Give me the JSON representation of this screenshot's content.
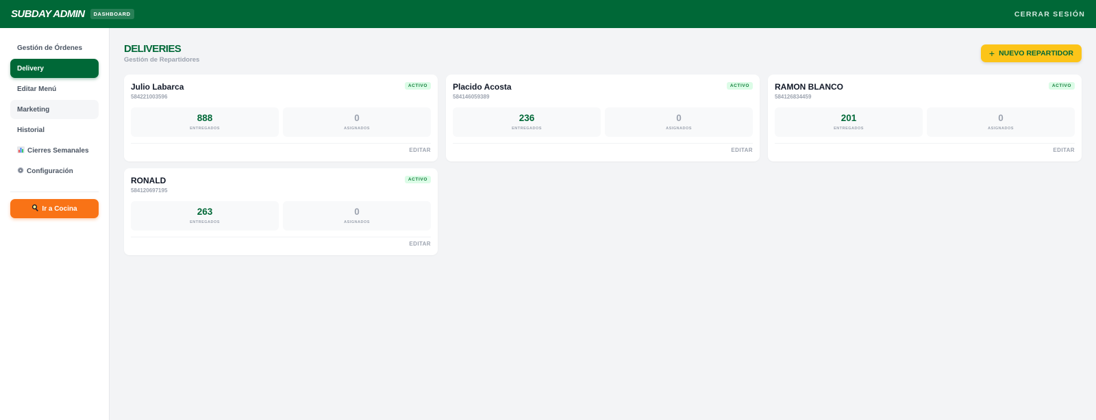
{
  "header": {
    "brand": "SUBDAY ADMIN",
    "badge": "DASHBOARD",
    "logout": "CERRAR SESIÓN"
  },
  "sidebar": {
    "items": [
      {
        "label": "Gestión de Órdenes",
        "icon": "",
        "active": false
      },
      {
        "label": "Delivery",
        "icon": "",
        "active": true
      },
      {
        "label": "Editar Menú",
        "icon": "",
        "active": false
      },
      {
        "label": "Marketing",
        "icon": "",
        "active": false
      },
      {
        "label": "Historial",
        "icon": "",
        "active": false
      },
      {
        "label": "Cierres Semanales",
        "icon": "bar-chart-icon",
        "active": false
      },
      {
        "label": "Configuración",
        "icon": "gear-icon",
        "active": false
      }
    ],
    "kitchen_button": "Ir a Cocina",
    "kitchen_icon": "frying-pan-icon"
  },
  "main": {
    "title": "DELIVERIES",
    "subtitle": "Gestión de Repartidores",
    "new_button": "NUEVO REPARTIDOR",
    "new_button_icon": "+",
    "cards": [
      {
        "name": "Julio Labarca",
        "phone": "584221003596",
        "status": "ACTIVO",
        "delivered": "888",
        "delivered_label": "ENTREGADOS",
        "assigned": "0",
        "assigned_label": "ASIGNADOS",
        "edit": "EDITAR"
      },
      {
        "name": "Placido Acosta",
        "phone": "584146059389",
        "status": "ACTIVO",
        "delivered": "236",
        "delivered_label": "ENTREGADOS",
        "assigned": "0",
        "assigned_label": "ASIGNADOS",
        "edit": "EDITAR"
      },
      {
        "name": "RAMON BLANCO",
        "phone": "584126834459",
        "status": "ACTIVO",
        "delivered": "201",
        "delivered_label": "ENTREGADOS",
        "assigned": "0",
        "assigned_label": "ASIGNADOS",
        "edit": "EDITAR"
      },
      {
        "name": "RONALD",
        "phone": "584120697195",
        "status": "ACTIVO",
        "delivered": "263",
        "delivered_label": "ENTREGADOS",
        "assigned": "0",
        "assigned_label": "ASIGNADOS",
        "edit": "EDITAR"
      }
    ]
  },
  "colors": {
    "brand_green": "#006837",
    "accent_yellow": "#fcc419",
    "kitchen_orange": "#f97316",
    "status_green": "#15803d"
  }
}
